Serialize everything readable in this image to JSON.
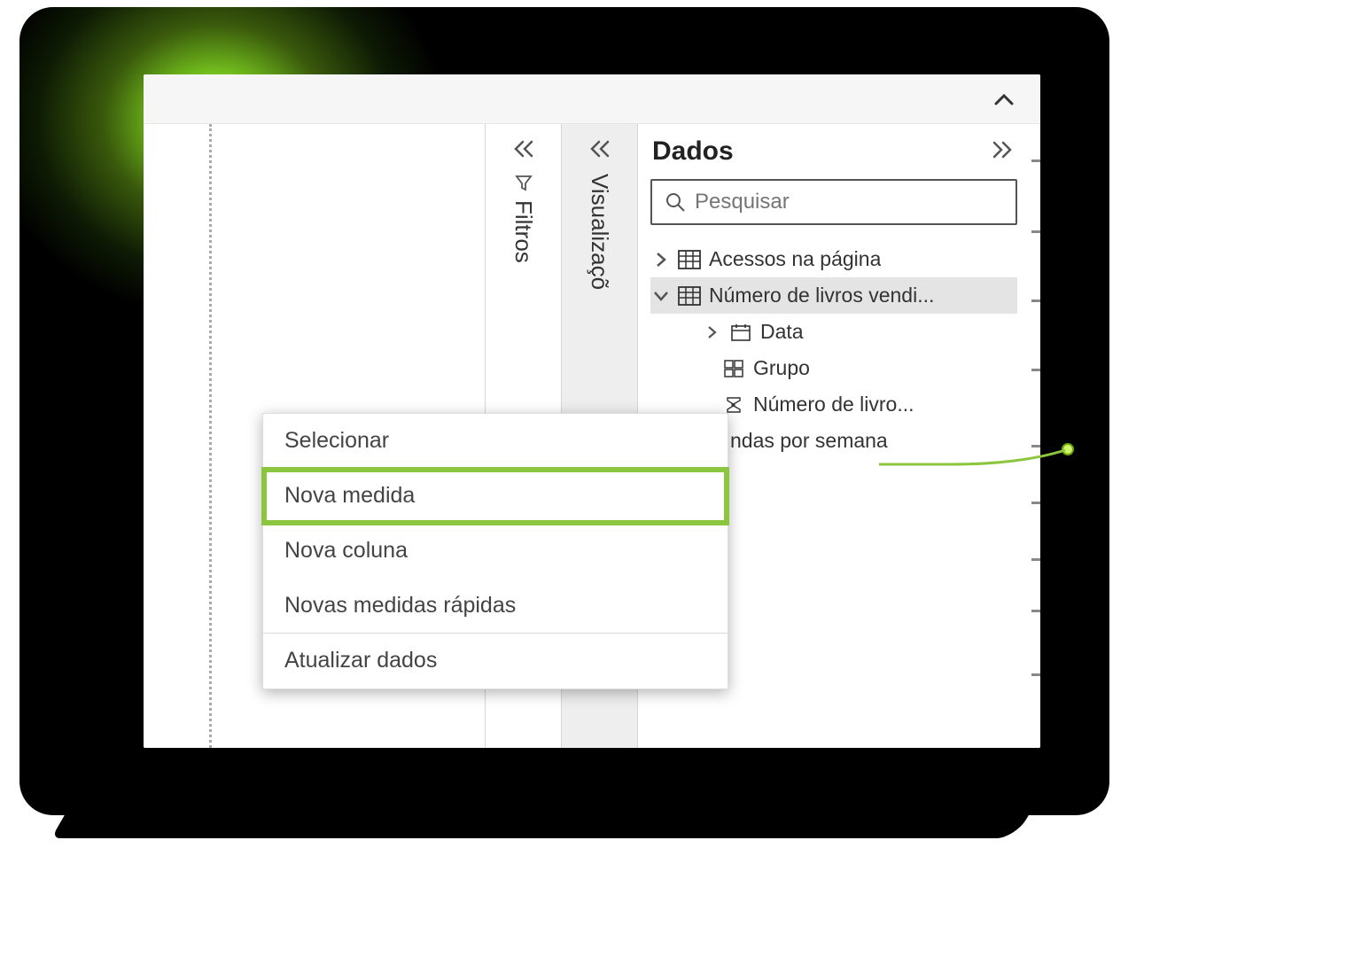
{
  "panels": {
    "filtros_label": "Filtros",
    "visualizacoes_label": "Visualizaçõ",
    "dados_title": "Dados"
  },
  "search": {
    "placeholder": "Pesquisar"
  },
  "tables": {
    "t1": {
      "label": "Acessos na página",
      "expanded": false
    },
    "t2": {
      "label": "Número de livros vendi...",
      "expanded": true,
      "fields": {
        "f1": {
          "label": "Data",
          "type": "date"
        },
        "f2": {
          "label": "Grupo",
          "type": "group"
        },
        "f3": {
          "label": "Número de livro...",
          "type": "measure"
        }
      }
    },
    "t3_fragment": "ndas por semana"
  },
  "context_menu": {
    "items": {
      "i0": "Selecionar",
      "i1": "Nova medida",
      "i2": "Nova coluna",
      "i3": "Novas medidas rápidas",
      "i4": "Atualizar dados"
    },
    "highlighted_index": 1
  },
  "colors": {
    "highlight": "#8cc63f"
  }
}
